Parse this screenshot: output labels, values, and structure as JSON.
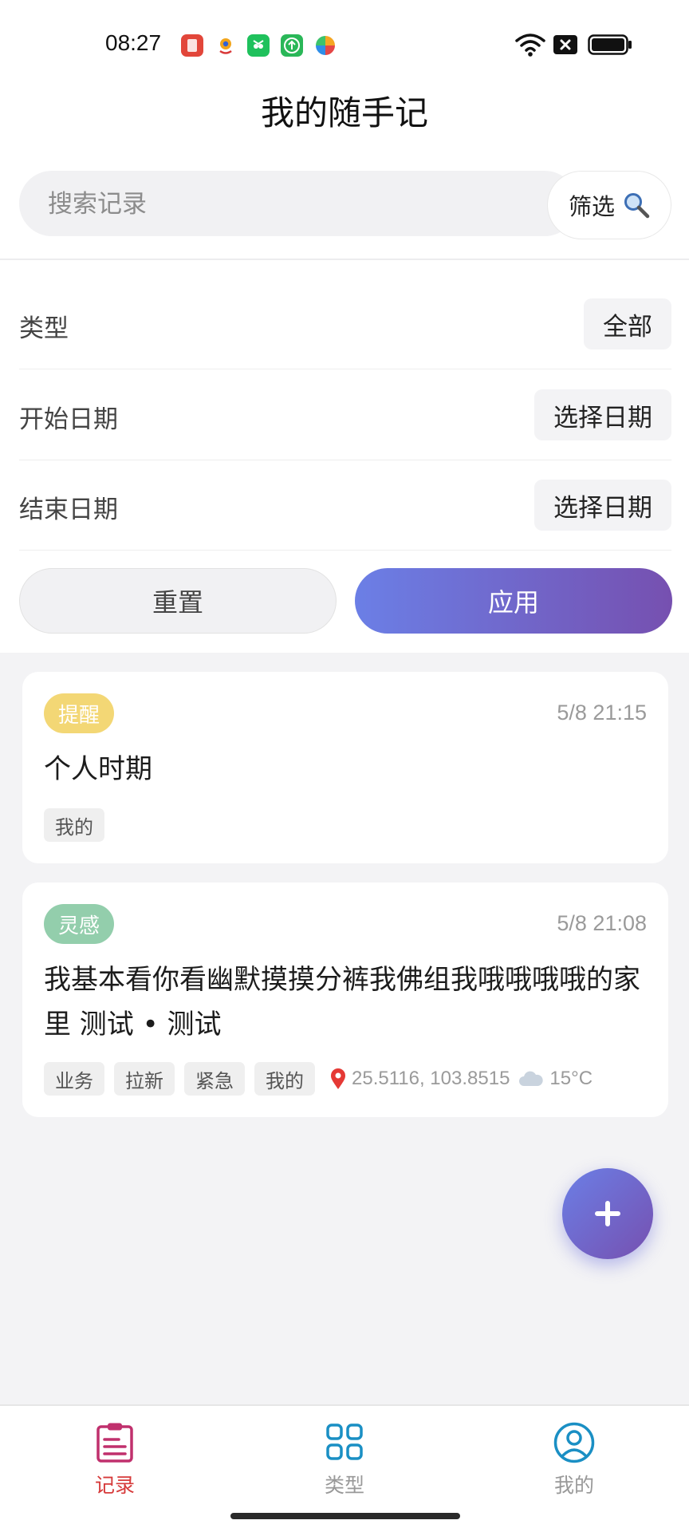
{
  "status_bar": {
    "time": "08:27",
    "notification_icons": [
      "red-app-icon",
      "location-app-icon",
      "wechat-icon",
      "upload-app-icon",
      "pinwheel-app-icon"
    ],
    "status_icons": [
      "wifi-icon",
      "sim-off-icon",
      "battery-icon"
    ]
  },
  "header": {
    "title": "我的随手记"
  },
  "search": {
    "placeholder": "搜索记录",
    "value": "",
    "filter_label": "筛选"
  },
  "filter": {
    "rows": [
      {
        "label": "类型",
        "value": "全部"
      },
      {
        "label": "开始日期",
        "value": "选择日期"
      },
      {
        "label": "结束日期",
        "value": "选择日期"
      }
    ],
    "reset_label": "重置",
    "apply_label": "应用"
  },
  "records": [
    {
      "type": "提醒",
      "type_color": "#f3d775",
      "time": "5/8 21:15",
      "content": "个人时期",
      "tags": [
        "我的"
      ]
    },
    {
      "type": "灵感",
      "type_color": "#93ceac",
      "time": "5/8 21:08",
      "content": "我基本看你看幽默摸摸分裤我佛组我哦哦哦哦的家里 测试 • 测试",
      "tags": [
        "业务",
        "拉新",
        "紧急",
        "我的"
      ],
      "location": "25.5116, 103.8515",
      "weather": "15°C"
    }
  ],
  "fab": {
    "icon": "plus-icon"
  },
  "bottom_nav": {
    "items": [
      {
        "label": "记录",
        "icon": "clipboard-icon",
        "active": true
      },
      {
        "label": "类型",
        "icon": "grid-icon",
        "active": false
      },
      {
        "label": "我的",
        "icon": "user-icon",
        "active": false
      }
    ]
  },
  "colors": {
    "accent_start": "#6b7fe6",
    "accent_end": "#7650b0",
    "nav_active": "#c0306d",
    "nav_active_label": "#d63a3a",
    "nav_inactive_icon": "#1a8fc4"
  }
}
